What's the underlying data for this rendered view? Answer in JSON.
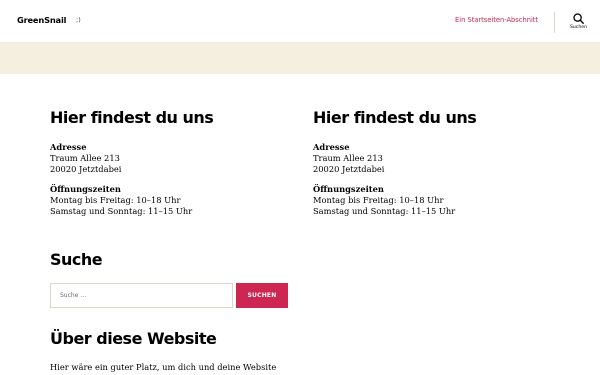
{
  "header": {
    "site_title": "GreenSnail",
    "site_description": ";)",
    "nav_link": "Ein Startseiten-Abschnitt",
    "search_toggle_label": "Suchen",
    "accent_color": "#cd2653"
  },
  "widgets": {
    "find_us": [
      {
        "title": "Hier findest du uns",
        "address_heading": "Adresse",
        "address_line1": "Traum Allee 213",
        "address_line2": "20020 Jetztdabei",
        "hours_heading": "Öffnungszeiten",
        "hours_line1": "Montag bis Freitag: 10–18 Uhr",
        "hours_line2": "Samstag und Sonntag: 11–15 Uhr"
      },
      {
        "title": "Hier findest du uns",
        "address_heading": "Adresse",
        "address_line1": "Traum Allee 213",
        "address_line2": "20020 Jetztdabei",
        "hours_heading": "Öffnungszeiten",
        "hours_line1": "Montag bis Freitag: 10–18 Uhr",
        "hours_line2": "Samstag und Sonntag: 11–15 Uhr"
      }
    ],
    "search": {
      "title": "Suche",
      "placeholder": "Suche …",
      "button_label": "SUCHEN"
    },
    "about": {
      "title": "Über diese Website",
      "text": "Hier wäre ein guter Platz, um dich und deine Website"
    }
  },
  "colors": {
    "band": "#f5efe0",
    "input_border": "#dcd7ca"
  }
}
